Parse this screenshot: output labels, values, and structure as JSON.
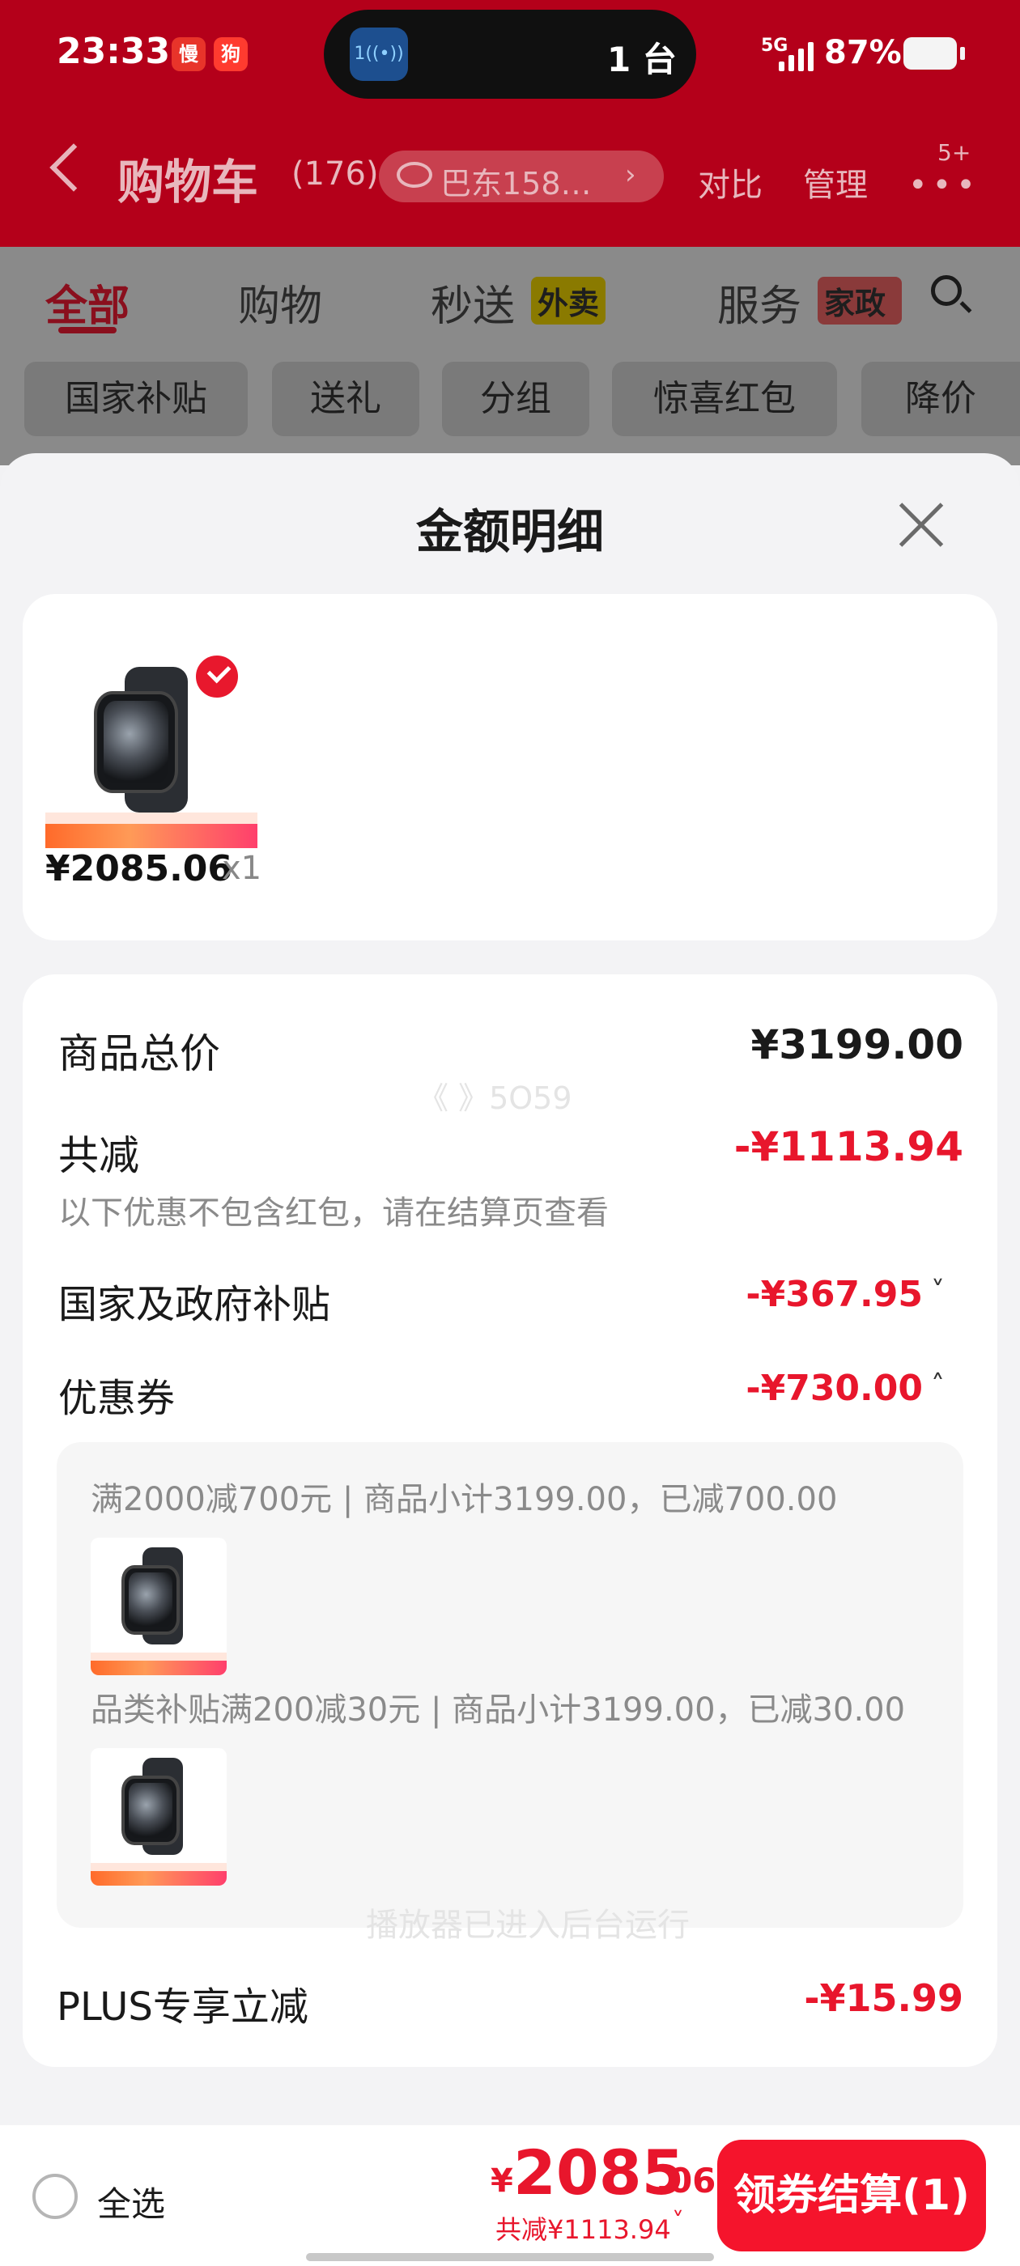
{
  "status_bar": {
    "time": "23:33",
    "island_icon_label": "1",
    "island_text": "1 台",
    "network": "5G",
    "battery": "87%"
  },
  "header": {
    "title": "购物车",
    "count": "(176)",
    "address": "巴东158…",
    "compare": "对比",
    "manage": "管理",
    "more_badge": "5+"
  },
  "tabs": [
    {
      "label": "全部"
    },
    {
      "label": "购物"
    },
    {
      "label": "秒送",
      "tag": "外卖"
    },
    {
      "label": "服务",
      "tag": "家政"
    }
  ],
  "chips": [
    "国家补贴",
    "送礼",
    "分组",
    "惊喜红包",
    "降价"
  ],
  "sheet": {
    "title": "金额明细",
    "item": {
      "price": "¥2085.06",
      "qty": "x1"
    },
    "rows": {
      "goods_total": {
        "label": "商品总价",
        "value": "¥3199.00"
      },
      "total_discount": {
        "label": "共减",
        "value": "-¥1113.94",
        "note": "以下优惠不包含红包，请在结算页查看"
      },
      "subsidy": {
        "label": "国家及政府补贴",
        "value": "-¥367.95"
      },
      "coupon": {
        "label": "优惠券",
        "value": "-¥730.00"
      },
      "plus": {
        "label": "PLUS专享立减",
        "value": "-¥15.99"
      }
    },
    "coupons": [
      {
        "text": "满2000减700元 | 商品小计3199.00，已减700.00"
      },
      {
        "text": "品类补贴满200减30元 | 商品小计3199.00，已减30.00"
      }
    ],
    "watermark_1": "《 》5O59",
    "watermark_2": "播放器已进入后台运行"
  },
  "bottom_bar": {
    "select_all": "全选",
    "currency": "¥",
    "total_int": "2085",
    "total_dec": ".06",
    "saved": "共减¥1113.94",
    "checkout": "领券结算(1)"
  }
}
